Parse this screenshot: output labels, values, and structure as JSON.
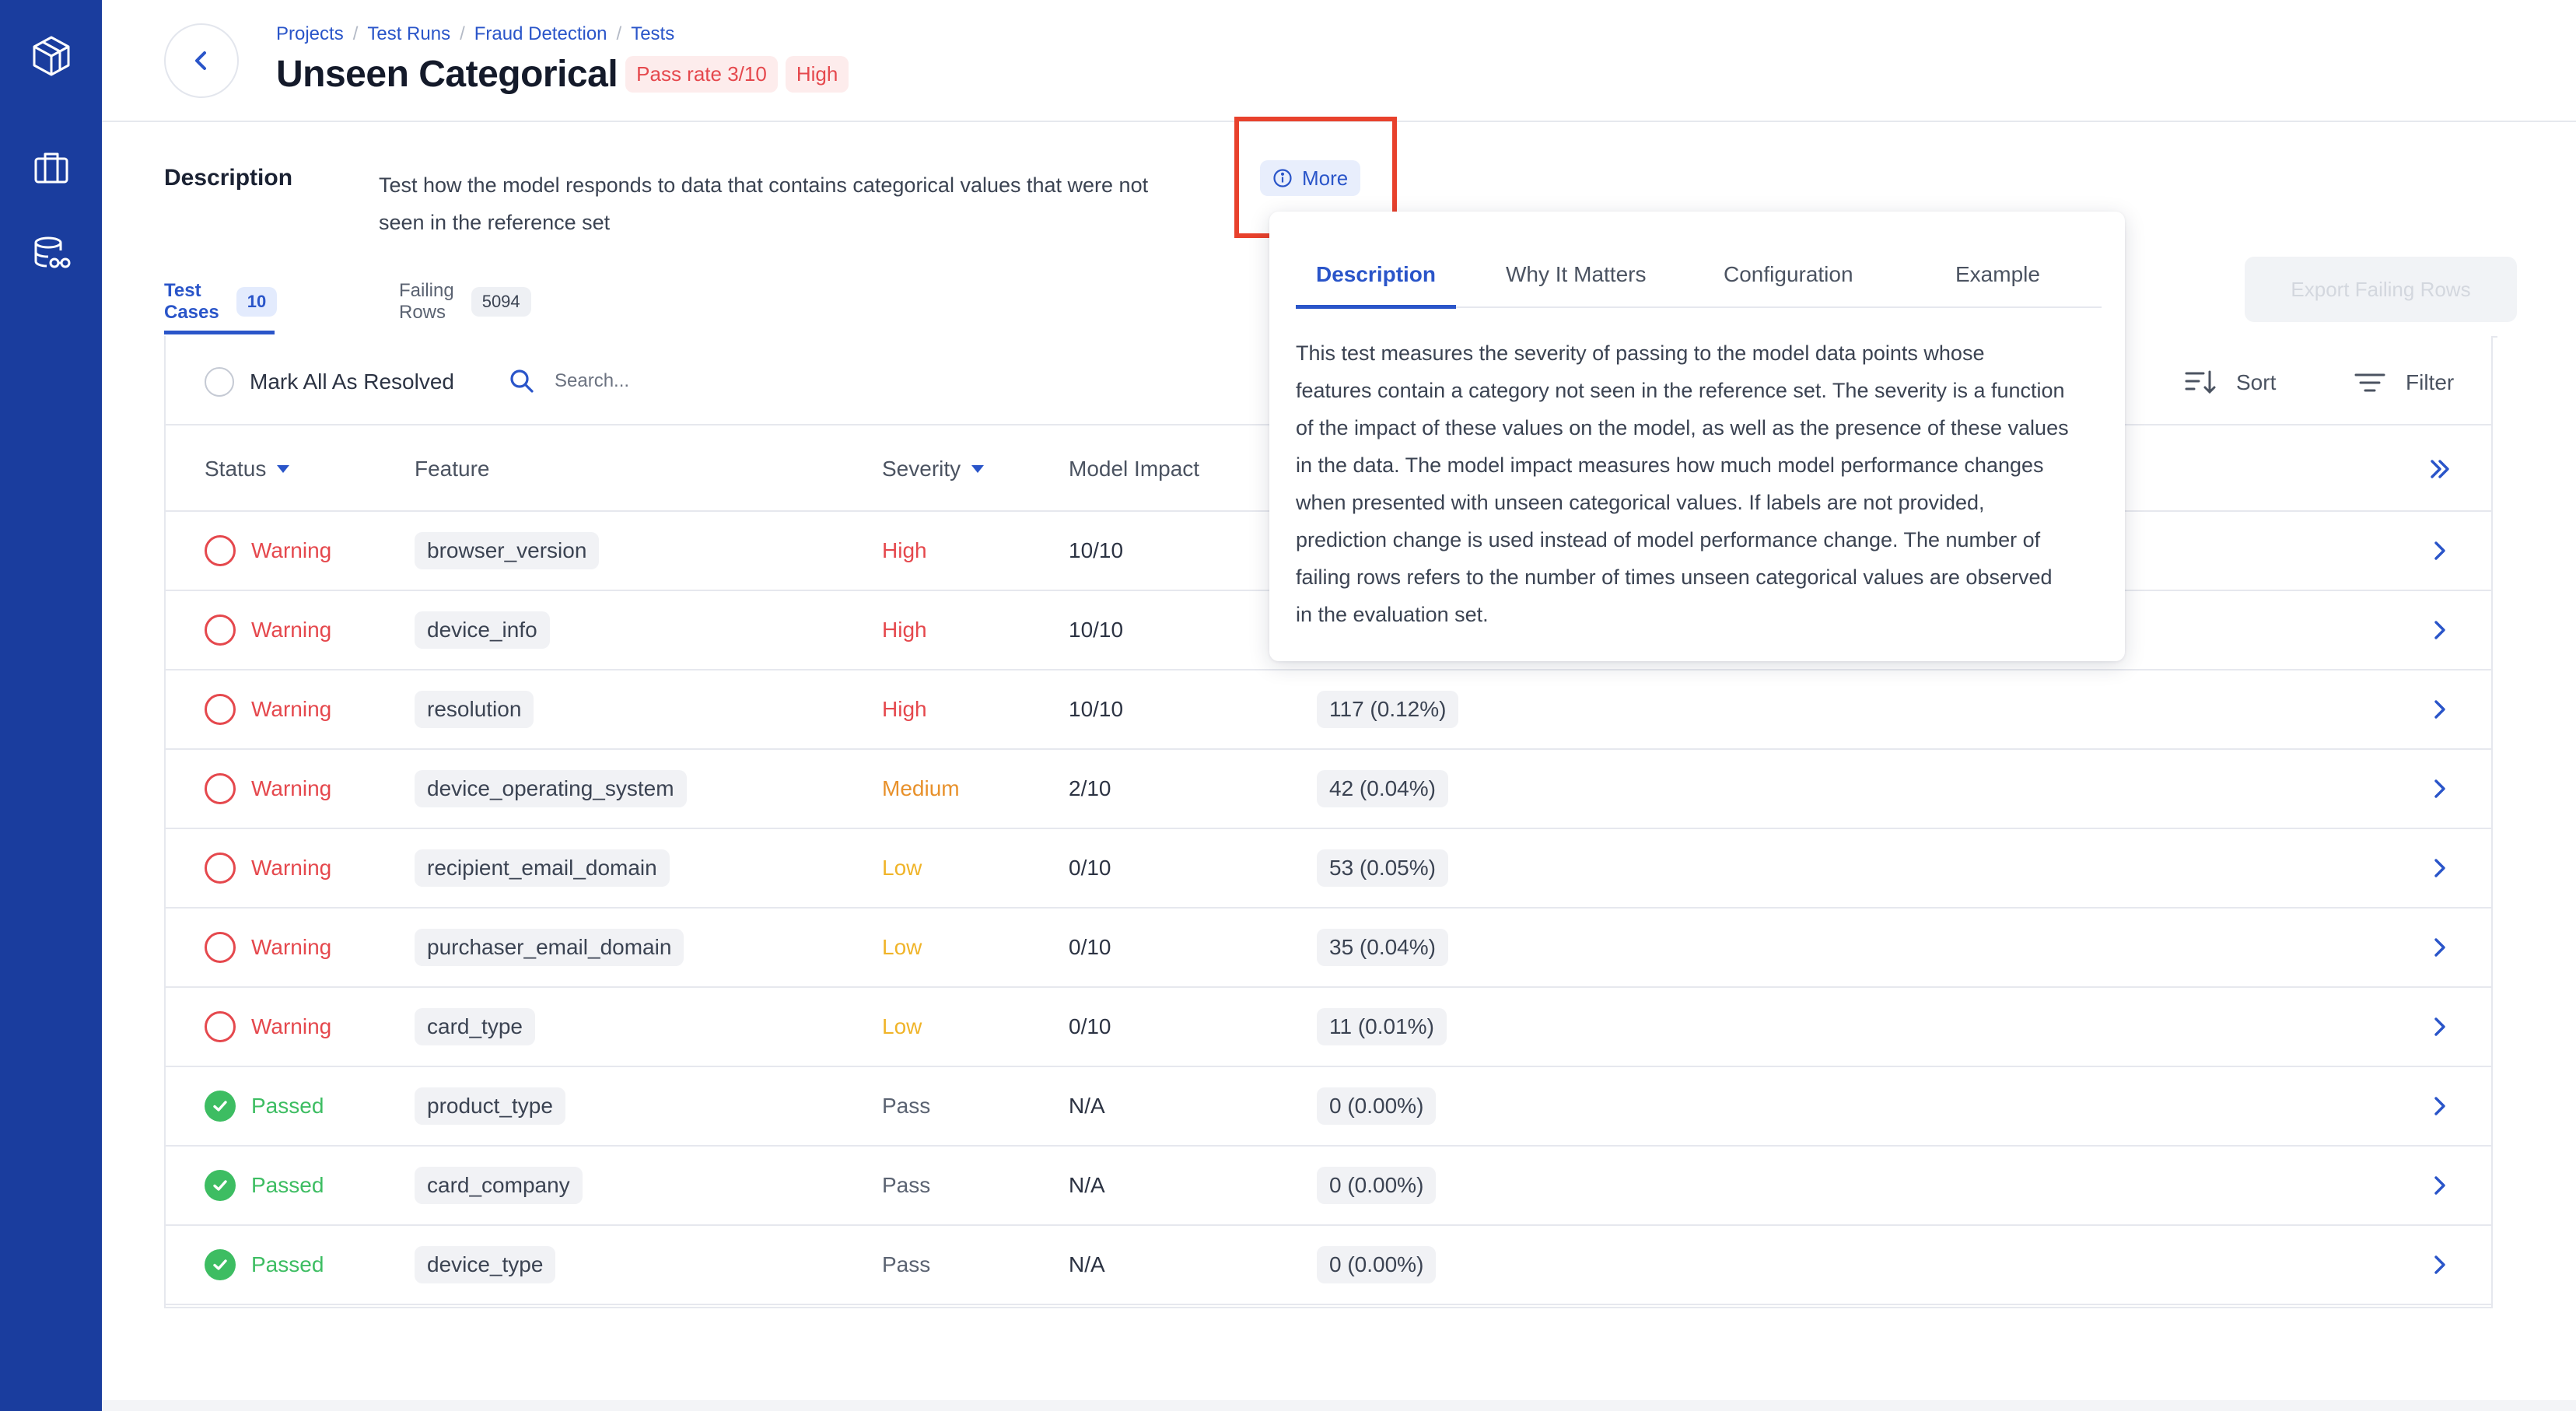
{
  "sidebar": {
    "items": [
      {
        "icon": "logo-cube-icon"
      },
      {
        "icon": "briefcase-icon"
      },
      {
        "icon": "database-glasses-icon"
      }
    ]
  },
  "breadcrumb": [
    "Projects",
    "Test Runs",
    "Fraud Detection",
    "Tests"
  ],
  "header": {
    "title": "Unseen Categorical",
    "pass_rate_badge": "Pass rate 3/10",
    "severity_badge": "High"
  },
  "description": {
    "label": "Description",
    "text_line1": "Test how the model responds to data that contains categorical values that were not",
    "text_line2": "seen in the reference set",
    "more_label": "More"
  },
  "tabs": [
    {
      "label": "Test Cases",
      "count": "10"
    },
    {
      "label": "Failing Rows",
      "count": "5094"
    }
  ],
  "toolbar": {
    "mark_all_label": "Mark All As Resolved",
    "search_placeholder": "Search...",
    "sort_label": "Sort",
    "filter_label": "Filter",
    "export_label": "Export Failing Rows"
  },
  "table": {
    "columns": {
      "status": "Status",
      "feature": "Feature",
      "severity": "Severity",
      "model_impact": "Model Impact"
    },
    "rows": [
      {
        "status": "Warning",
        "feature": "browser_version",
        "severity": "High",
        "impact": "10/10",
        "failing": ""
      },
      {
        "status": "Warning",
        "feature": "device_info",
        "severity": "High",
        "impact": "10/10",
        "failing": ""
      },
      {
        "status": "Warning",
        "feature": "resolution",
        "severity": "High",
        "impact": "10/10",
        "failing": "117 (0.12%)"
      },
      {
        "status": "Warning",
        "feature": "device_operating_system",
        "severity": "Medium",
        "impact": "2/10",
        "failing": "42 (0.04%)"
      },
      {
        "status": "Warning",
        "feature": "recipient_email_domain",
        "severity": "Low",
        "impact": "0/10",
        "failing": "53 (0.05%)"
      },
      {
        "status": "Warning",
        "feature": "purchaser_email_domain",
        "severity": "Low",
        "impact": "0/10",
        "failing": "35 (0.04%)"
      },
      {
        "status": "Warning",
        "feature": "card_type",
        "severity": "Low",
        "impact": "0/10",
        "failing": "11 (0.01%)"
      },
      {
        "status": "Passed",
        "feature": "product_type",
        "severity": "Pass",
        "impact": "N/A",
        "failing": "0 (0.00%)"
      },
      {
        "status": "Passed",
        "feature": "card_company",
        "severity": "Pass",
        "impact": "N/A",
        "failing": "0 (0.00%)"
      },
      {
        "status": "Passed",
        "feature": "device_type",
        "severity": "Pass",
        "impact": "N/A",
        "failing": "0 (0.00%)"
      }
    ]
  },
  "popover": {
    "tabs": [
      "Description",
      "Why It Matters",
      "Configuration",
      "Example"
    ],
    "lines": [
      "This test measures the severity of passing to the model data points whose",
      "features contain a category not seen in the reference set. The severity is a function",
      "of the impact of these values on the model, as well as the presence of these values",
      "in the data. The model impact measures how much model performance changes",
      "when presented with unseen categorical values. If labels are not provided,",
      "prediction change is used instead of model performance change. The number of",
      "failing rows refers to the number of times unseen categorical values are observed",
      "in the evaluation set."
    ]
  },
  "colors": {
    "sidebar": "#1a3d9e",
    "accent": "#2a55c9",
    "warning": "#e5484d",
    "passed": "#3dbd62",
    "medium": "#e8912b",
    "low": "#f0b429",
    "highlight": "#e8412c"
  }
}
